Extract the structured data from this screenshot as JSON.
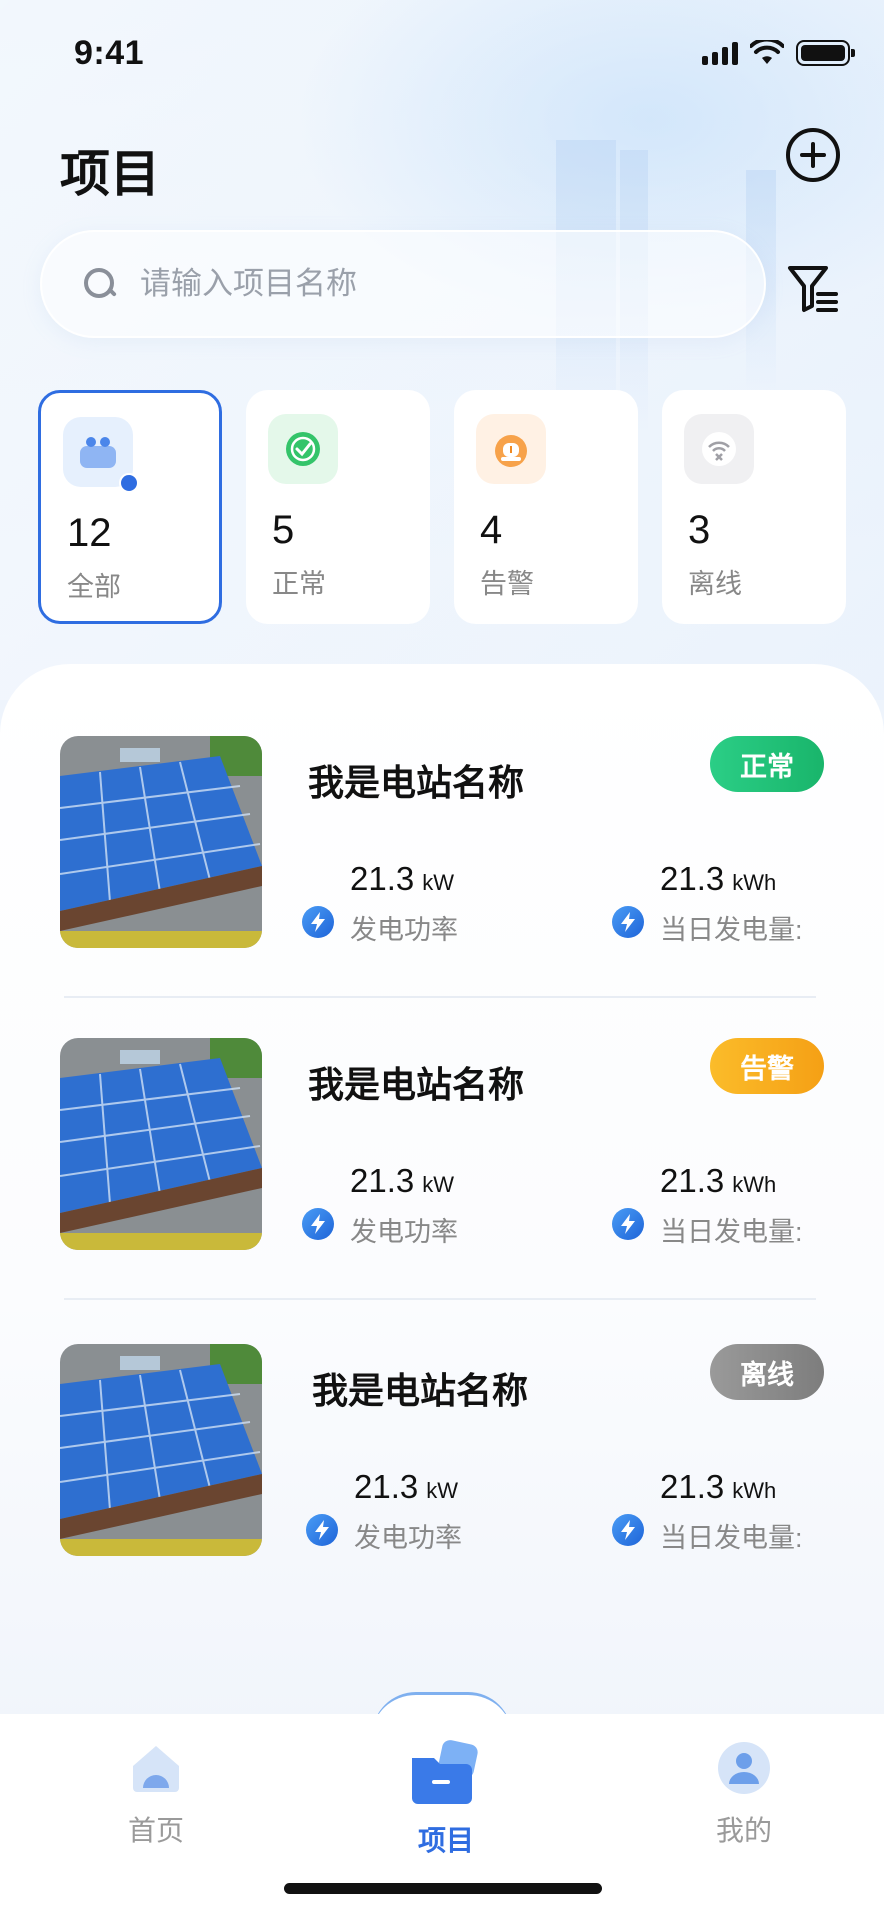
{
  "status_bar": {
    "time": "9:41"
  },
  "header": {
    "title": "项目"
  },
  "search": {
    "placeholder": "请输入项目名称"
  },
  "stats": [
    {
      "count": "12",
      "label": "全部",
      "icon": "all-projects-icon",
      "active": true
    },
    {
      "count": "5",
      "label": "正常",
      "icon": "normal-check-icon"
    },
    {
      "count": "4",
      "label": "告警",
      "icon": "alarm-siren-icon"
    },
    {
      "count": "3",
      "label": "离线",
      "icon": "offline-wifi-icon"
    }
  ],
  "stations": [
    {
      "name": "我是电站名称",
      "status": "正常",
      "status_color": "#21c17a",
      "power_value": "21.3",
      "power_unit": "kW",
      "power_label": "发电功率",
      "energy_value": "21.3",
      "energy_unit": "kWh",
      "energy_label": "当日发电量:"
    },
    {
      "name": "我是电站名称",
      "status": "告警",
      "status_color": "#f8a51c",
      "power_value": "21.3",
      "power_unit": "kW",
      "power_label": "发电功率",
      "energy_value": "21.3",
      "energy_unit": "kWh",
      "energy_label": "当日发电量:"
    },
    {
      "name": "我是电站名称",
      "status": "离线",
      "status_color": "#8c8c8c",
      "power_value": "21.3",
      "power_unit": "kW",
      "power_label": "发电功率",
      "energy_value": "21.3",
      "energy_unit": "kWh",
      "energy_label": "当日发电量:"
    }
  ],
  "tabbar": {
    "items": [
      {
        "label": "首页",
        "icon": "home-icon",
        "active": false
      },
      {
        "label": "项目",
        "icon": "projects-folder-icon",
        "active": true
      },
      {
        "label": "我的",
        "icon": "profile-icon",
        "active": false
      }
    ]
  },
  "colors": {
    "accent": "#2f6de1",
    "normal": "#21c17a",
    "alarm": "#f8a51c",
    "offline": "#8c8c8c"
  }
}
